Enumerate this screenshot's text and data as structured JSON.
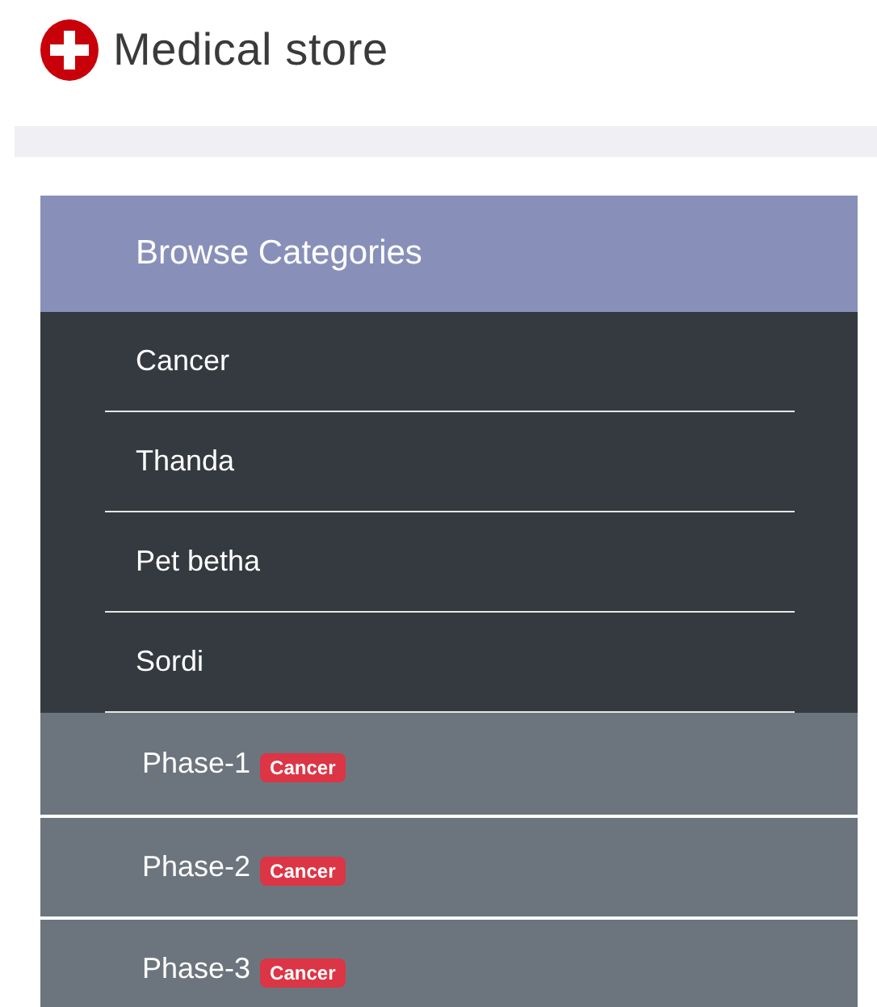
{
  "header": {
    "title": "Medical store"
  },
  "panel": {
    "title": "Browse Categories",
    "categories": [
      {
        "label": "Cancer"
      },
      {
        "label": "Thanda"
      },
      {
        "label": "Pet betha"
      },
      {
        "label": "Sordi"
      }
    ],
    "phases": [
      {
        "label": "Phase-1",
        "badge": "Cancer"
      },
      {
        "label": "Phase-2",
        "badge": "Cancer"
      },
      {
        "label": "Phase-3",
        "badge": "Cancer"
      }
    ]
  }
}
